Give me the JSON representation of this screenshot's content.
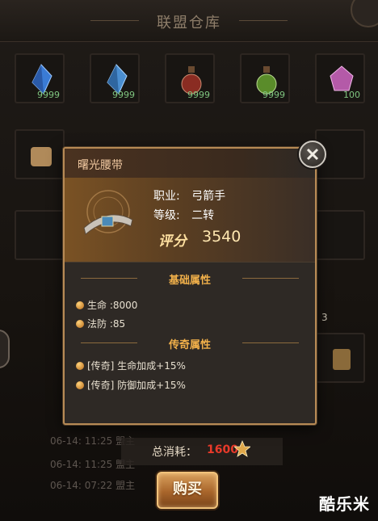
{
  "warehouse": {
    "title": "联盟仓库",
    "slots_row1": [
      {
        "icon": "blue-crystal-icon",
        "qty": "9999"
      },
      {
        "icon": "blue-crystal-icon",
        "qty": "9999"
      },
      {
        "icon": "red-potion-icon",
        "qty": "9999"
      },
      {
        "icon": "green-potion-icon",
        "qty": "9999"
      },
      {
        "icon": "purple-gem-icon",
        "qty": "100"
      }
    ],
    "side_number": "3",
    "logs": [
      {
        "time": "06-14: 11:25",
        "text": "盟主"
      },
      {
        "time": "06-14: 11:25",
        "text": "盟主"
      },
      {
        "time": "06-14: 07:22",
        "text": "盟主"
      }
    ]
  },
  "purchase": {
    "cost_label": "总消耗：",
    "cost_value": "1600",
    "buy_label": "购买"
  },
  "item": {
    "name": "曙光腰带",
    "class_label": "职业:",
    "class_value": "弓箭手",
    "grade_label": "等级:",
    "grade_value": "二转",
    "score_label": "评分",
    "score_value": "3540",
    "base_section": "基础属性",
    "base_attrs": [
      "生命 :8000",
      "法防 :85"
    ],
    "legend_section": "传奇属性",
    "legend_attrs": [
      "[传奇] 生命加成+15%",
      "[传奇] 防御加成+15%"
    ]
  },
  "watermark": "酷乐米",
  "colors": {
    "accent_gold": "#b78a55",
    "cost_red": "#e83a2a",
    "qty_green": "#7fc47f"
  }
}
